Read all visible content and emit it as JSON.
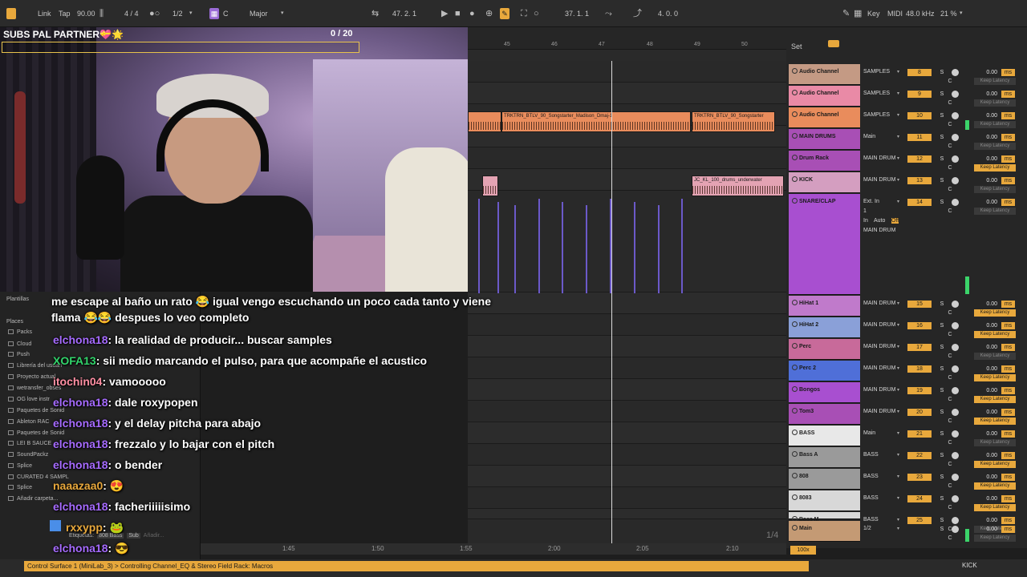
{
  "transport": {
    "link": "Link",
    "tap": "Tap",
    "tempo": "90.00",
    "signature": "4 / 4",
    "quantize": "1/2",
    "key": "C",
    "scale": "Major",
    "position": "47.  2.  1",
    "loop_start": "37.  1.  1",
    "loop_length": "4.  0.  0",
    "key_label": "Key",
    "midi_label": "MIDI",
    "sample_rate": "48.0 kHz",
    "cpu": "21 %"
  },
  "overlay": {
    "subs_label": "SUBS PAL PARTNER💝🌟",
    "subs_count": "0 / 20",
    "subs_progress": 0
  },
  "ruler": {
    "bars": [
      "45",
      "46",
      "47",
      "48",
      "49",
      "50"
    ],
    "set_label": "Set"
  },
  "clips": [
    {
      "title": "TRKTRN_BTLV_90_Songstarter_Madison_Dmaj-1"
    },
    {
      "title": "TRKTRN_BTLV_90_Songstarter"
    },
    {
      "title": "JC_KL_100_drums_underwater"
    }
  ],
  "browser": {
    "items": [
      "Plantillas",
      "Places",
      "Packs",
      "Cloud",
      "Push",
      "Librería del usuari",
      "Proyecto actual",
      "wetransfer_obses",
      "OG love instr",
      "Paquetes de Sonid",
      "Ableton RAC",
      "Paquetes de Sonid",
      "LEI B SAUCE",
      "SoundPackz",
      "Splice",
      "CURATED 4 SAMPL",
      "Splice",
      "Añadir carpeta..."
    ],
    "tags_label": "Etiquetas:",
    "tag1": "808 Bass",
    "tag2": "Sub",
    "tag3": "Añadir..."
  },
  "tracks": [
    {
      "name": "Audio Channel",
      "color": "#c49a84",
      "io": "SAMPLES",
      "num": "8",
      "vol": "0.00",
      "kl": "Keep Latency",
      "kl_on": false
    },
    {
      "name": "Audio Channel",
      "color": "#e98aa6",
      "io": "SAMPLES",
      "num": "9",
      "vol": "0.00",
      "kl": "Keep Latency",
      "kl_on": false
    },
    {
      "name": "Audio Channel",
      "color": "#e98c5c",
      "io": "SAMPLES",
      "num": "10",
      "vol": "0.00",
      "kl": "Keep Latency",
      "kl_on": false
    },
    {
      "name": "MAIN DRUMS",
      "color": "#a84fb5",
      "io": "Main",
      "num": "11",
      "vol": "0.00",
      "kl": "Keep Latency",
      "kl_on": false
    },
    {
      "name": "Drum Rack",
      "color": "#a84fb5",
      "io": "MAIN DRUM",
      "num": "12",
      "vol": "0.00",
      "kl": "Keep Latency",
      "kl_on": true
    },
    {
      "name": "KICK",
      "color": "#d49ec0",
      "io": "MAIN DRUM",
      "num": "13",
      "vol": "0.00",
      "kl": "Keep Latency",
      "kl_on": false
    },
    {
      "name": "SNARE/CLAP",
      "color": "#a84fd0",
      "io": "Ext. In",
      "num": "14",
      "vol": "0.00",
      "kl": "Keep Latency",
      "kl_on": false
    },
    {
      "name": "HiHat 1",
      "color": "#c07acb",
      "io": "MAIN DRUM",
      "num": "15",
      "vol": "0.00",
      "kl": "Keep Latency",
      "kl_on": true
    },
    {
      "name": "HiHat 2",
      "color": "#8aa0d8",
      "io": "MAIN DRUM",
      "num": "16",
      "vol": "0.00",
      "kl": "Keep Latency",
      "kl_on": true
    },
    {
      "name": "Perc",
      "color": "#c86a9a",
      "io": "MAIN DRUM",
      "num": "17",
      "vol": "0.00",
      "kl": "Keep Latency",
      "kl_on": false
    },
    {
      "name": "Perc 2",
      "color": "#4f6fd8",
      "io": "MAIN DRUM",
      "num": "18",
      "vol": "0.00",
      "kl": "Keep Latency",
      "kl_on": true
    },
    {
      "name": "Bongos",
      "color": "#a84fd0",
      "io": "MAIN DRUM",
      "num": "19",
      "vol": "0.00",
      "kl": "Keep Latency",
      "kl_on": true
    },
    {
      "name": "Tom3",
      "color": "#a84fb5",
      "io": "MAIN DRUM",
      "num": "20",
      "vol": "0.00",
      "kl": "Keep Latency",
      "kl_on": true
    },
    {
      "name": "BASS",
      "color": "#e8e8e8",
      "io": "Main",
      "num": "21",
      "vol": "0.00",
      "kl": "Keep Latency",
      "kl_on": false
    },
    {
      "name": "Bass A",
      "color": "#9a9a9a",
      "io": "BASS",
      "num": "22",
      "vol": "0.00",
      "kl": "Keep Latency",
      "kl_on": true
    },
    {
      "name": "808",
      "color": "#9a9a9a",
      "io": "BASS",
      "num": "23",
      "vol": "0.00",
      "kl": "Keep Latency",
      "kl_on": true
    },
    {
      "name": "8083",
      "color": "#d8d8d8",
      "io": "BASS",
      "num": "24",
      "vol": "0.00",
      "kl": "Keep Latency",
      "kl_on": true
    },
    {
      "name": "Bass M",
      "color": "#d8d8d8",
      "io": "BASS",
      "num": "25",
      "vol": "0.00",
      "kl": "Keep Latency",
      "kl_on": false
    },
    {
      "name": "Main",
      "color": "#c49a74",
      "io": "1/2",
      "num": "",
      "vol": "0.00",
      "kl": "Keep Latency",
      "kl_on": false
    }
  ],
  "snare_io": {
    "in": "In",
    "auto": "Auto",
    "off": "Off",
    "channel": "1",
    "dest": "MAIN DRUM"
  },
  "chat": [
    {
      "user": "",
      "user_color": "#ffffff",
      "text": "me escape al baño un rato 😂 igual vengo escuchando un poco cada tanto y viene"
    },
    {
      "user": "",
      "user_color": "#ffffff",
      "text": "flama 😂😂 despues lo veo completo"
    },
    {
      "user": "elchona18",
      "user_color": "#a66bff",
      "text": ": la realidad de producir... buscar samples"
    },
    {
      "user": "XOFA13",
      "user_color": "#32d46b",
      "text": ": sii medio marcando el pulso, para que acompañe el acustico"
    },
    {
      "user": "itochin04",
      "user_color": "#ff8fa3",
      "text": ": vamooooo"
    },
    {
      "user": "elchona18",
      "user_color": "#a66bff",
      "text": ": dale roxypopen"
    },
    {
      "user": "elchona18",
      "user_color": "#a66bff",
      "text": ": y el delay pitcha para abajo"
    },
    {
      "user": "elchona18",
      "user_color": "#a66bff",
      "text": ": frezzalo y lo bajar con el pitch"
    },
    {
      "user": "elchona18",
      "user_color": "#a66bff",
      "text": ": o bender"
    },
    {
      "user": "naaazaa0",
      "user_color": "#e8a83c",
      "text": ": 😍"
    },
    {
      "user": "elchona18",
      "user_color": "#a66bff",
      "text": ": facheriiiiisimo"
    },
    {
      "user": "rxxypp",
      "user_color": "#e8a83c",
      "text": ": 🐸"
    },
    {
      "user": "elchona18",
      "user_color": "#a66bff",
      "text": ": 😎"
    }
  ],
  "timeline": {
    "labels": [
      "1:45",
      "1:50",
      "1:55",
      "2:00",
      "2:05",
      "2:10"
    ],
    "page": "1/4",
    "zoom": "100x"
  },
  "status": {
    "text": "Control Surface 1 (MiniLab_3) > Controlling Channel_EQ & Stereo Field Rack: Macros",
    "track": "KICK"
  }
}
